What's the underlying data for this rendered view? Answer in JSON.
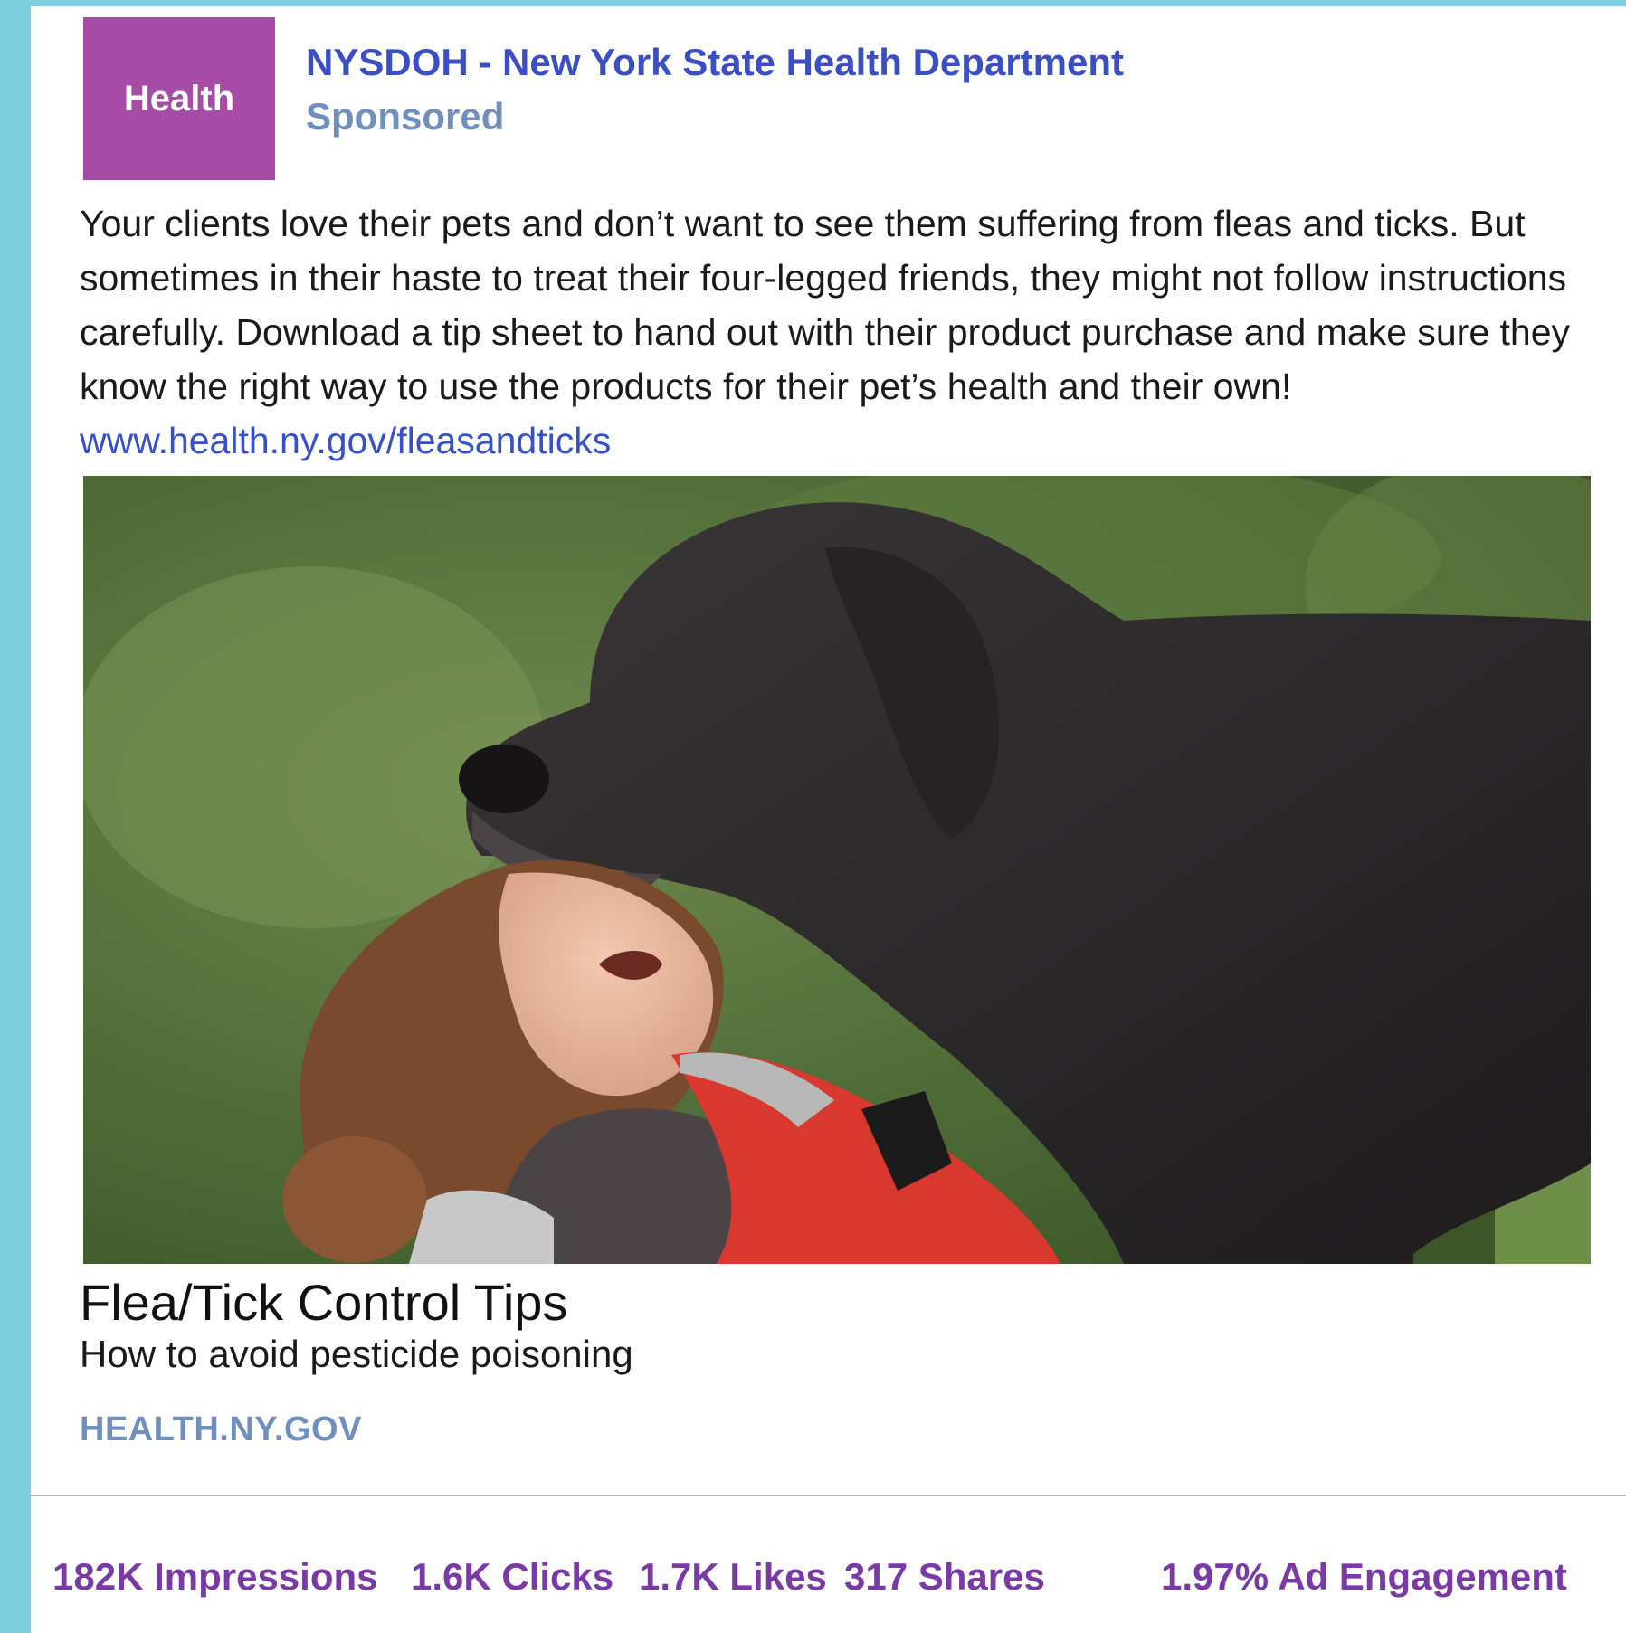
{
  "post": {
    "logo_text": "Health",
    "org_name": "NYSDOH - New York State Health Department",
    "sponsored": "Sponsored",
    "body": "Your clients love their pets and don’t want to see them suffering from fleas and ticks. But sometimes in their haste to treat their four-legged friends, they might not follow instructions carefully.  Download a tip sheet to hand out with their product purchase and make sure they know the right way to use the products for their pet’s health and their own!",
    "body_link": "www.health.ny.gov/fleasandticks",
    "headline": "Flea/Tick Control Tips",
    "subhead": "How to avoid pesticide poisoning",
    "domain": "HEALTH.NY.GOV"
  },
  "stats": {
    "impressions": "182K Impressions",
    "clicks": "1.6K Clicks",
    "likes": "1.7K Likes",
    "shares": "317 Shares",
    "engagement": "1.97% Ad Engagement"
  },
  "colors": {
    "frame_border": "#7ecfdf",
    "logo_bg": "#a64ca6",
    "org_name": "#3a4fc4",
    "sponsored": "#6f8fbf",
    "link": "#3650c8",
    "stats": "#7a3aa6"
  }
}
